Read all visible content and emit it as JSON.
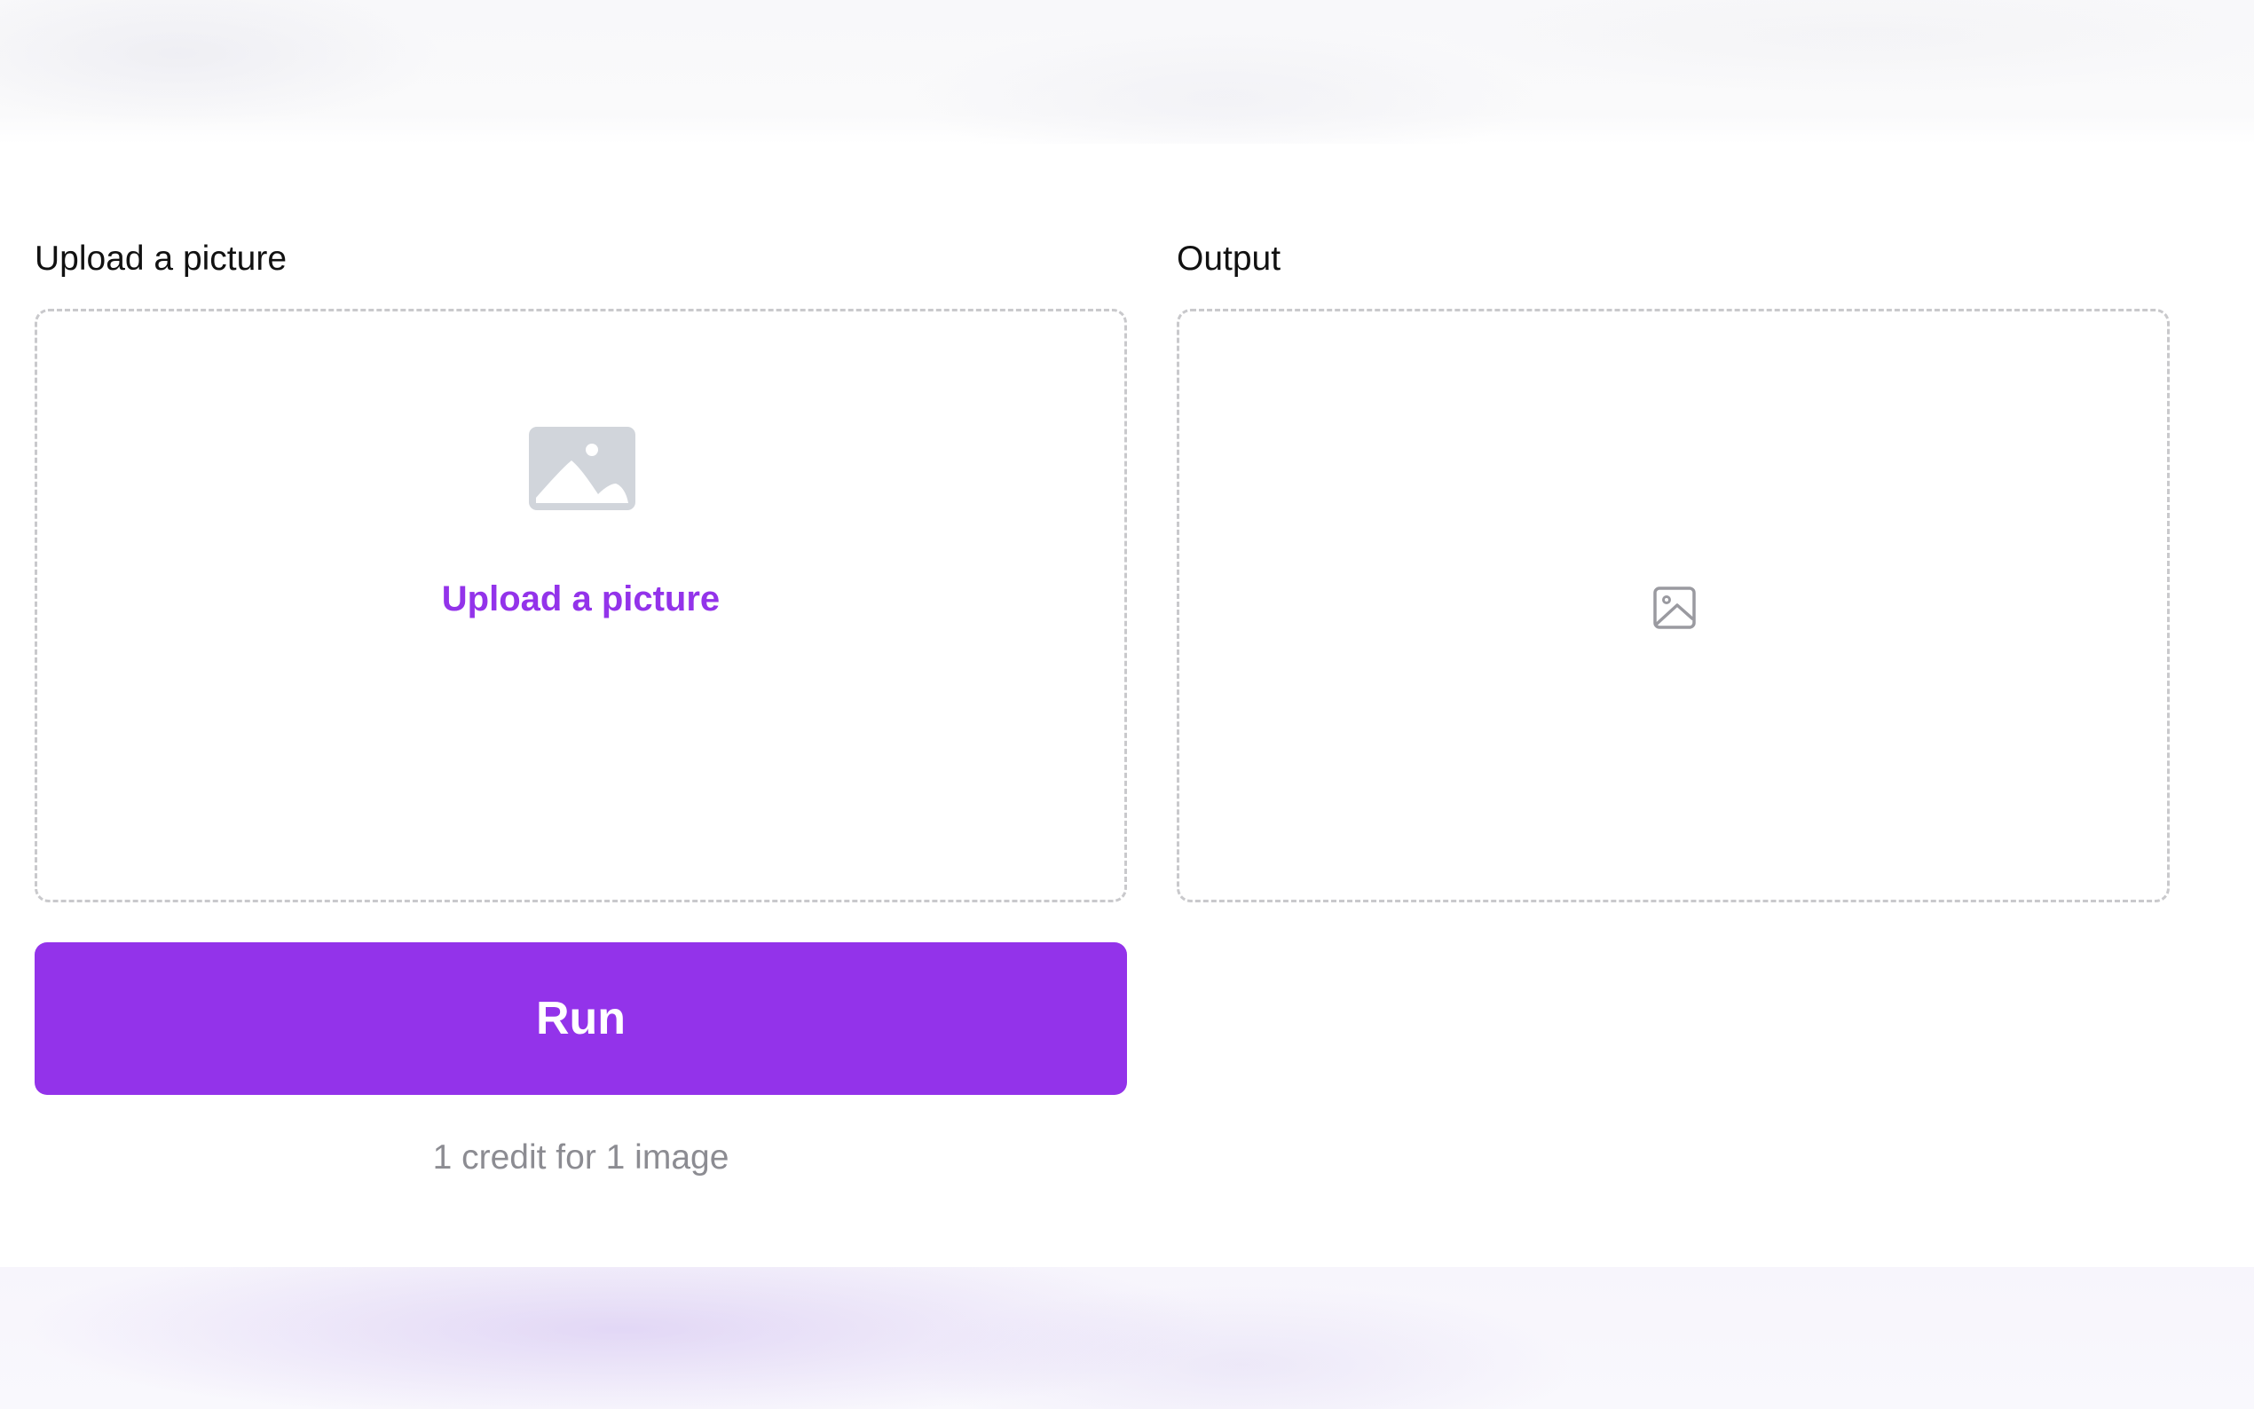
{
  "upload_panel": {
    "label": "Upload a picture",
    "dropzone_icon": "image-placeholder-icon",
    "dropzone_link": "Upload a picture"
  },
  "output_panel": {
    "label": "Output",
    "placeholder_icon": "image-outline-icon"
  },
  "actions": {
    "run_label": "Run",
    "credit_note": "1 credit for 1 image"
  },
  "colors": {
    "accent": "#9333ea",
    "dashed_border": "#c9c9cc",
    "muted_text": "#8c8c92",
    "icon_gray": "#d1d5db"
  }
}
